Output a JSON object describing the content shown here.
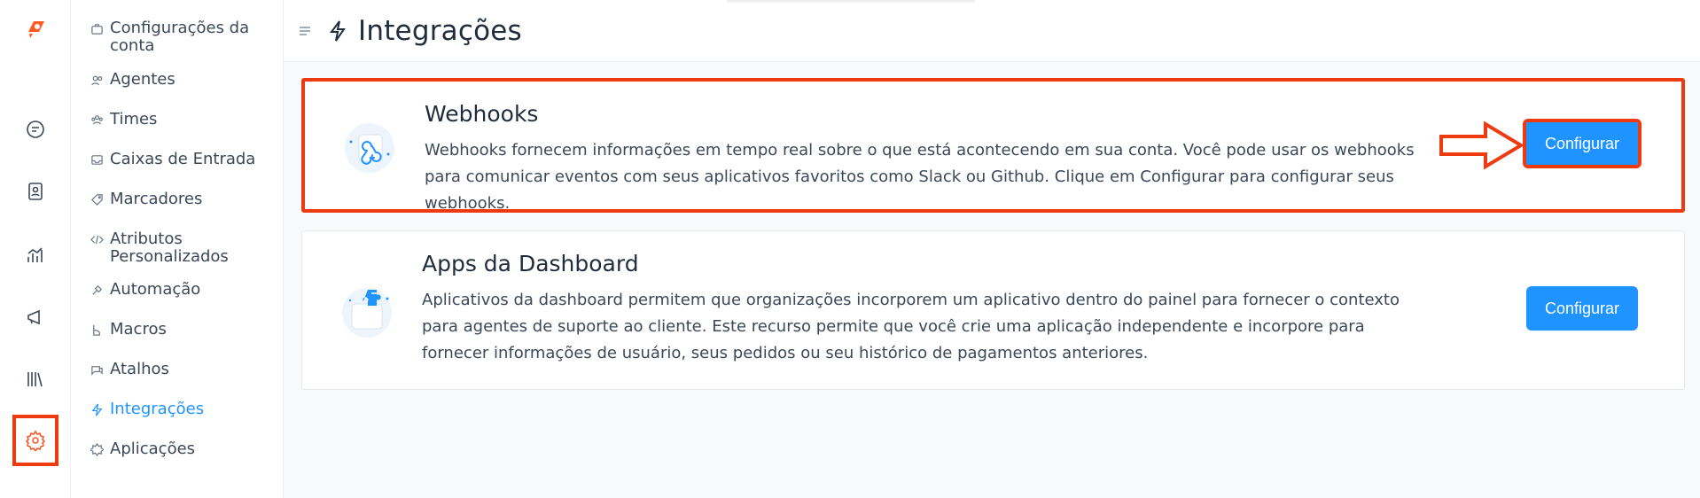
{
  "header": {
    "title": "Integrações"
  },
  "sidebar": {
    "items": [
      {
        "label": "Configurações da conta",
        "icon": "briefcase-icon"
      },
      {
        "label": "Agentes",
        "icon": "people-icon"
      },
      {
        "label": "Times",
        "icon": "team-icon"
      },
      {
        "label": "Caixas de Entrada",
        "icon": "inbox-icon"
      },
      {
        "label": "Marcadores",
        "icon": "tag-icon"
      },
      {
        "label": "Atributos Personalizados",
        "icon": "code-icon"
      },
      {
        "label": "Automação",
        "icon": "automation-icon"
      },
      {
        "label": "Macros",
        "icon": "macros-icon"
      },
      {
        "label": "Atalhos",
        "icon": "chat-bubble-icon"
      },
      {
        "label": "Integrações",
        "icon": "bolt-icon",
        "active": true
      },
      {
        "label": "Aplicações",
        "icon": "star-badge-icon"
      }
    ]
  },
  "rail": {
    "items": [
      "conversations-icon",
      "contacts-icon",
      "reports-icon",
      "campaigns-icon",
      "library-icon",
      "settings-icon"
    ],
    "active": "settings-icon"
  },
  "integrations": [
    {
      "title": "Webhooks",
      "description": "Webhooks fornecem informações em tempo real sobre o que está acontecendo em sua conta. Você pode usar os webhooks para comunicar eventos com seus aplicativos favoritos como Slack ou Github. Clique em Configurar para configurar seus webhooks.",
      "button": "Configurar",
      "icon": "webhook-icon"
    },
    {
      "title": "Apps da Dashboard",
      "description": "Aplicativos da dashboard permitem que organizações incorporem um aplicativo dentro do painel para fornecer o contexto para agentes de suporte ao cliente. Este recurso permite que você crie uma aplicação independente e incorpore para fornecer informações de usuário, seus pedidos ou seu histórico de pagamentos anteriores.",
      "button": "Configurar",
      "icon": "puzzle-icon"
    }
  ],
  "colors": {
    "accent": "#1f93ff",
    "highlight": "#ee3a10",
    "logo": "#ff5a1f"
  }
}
